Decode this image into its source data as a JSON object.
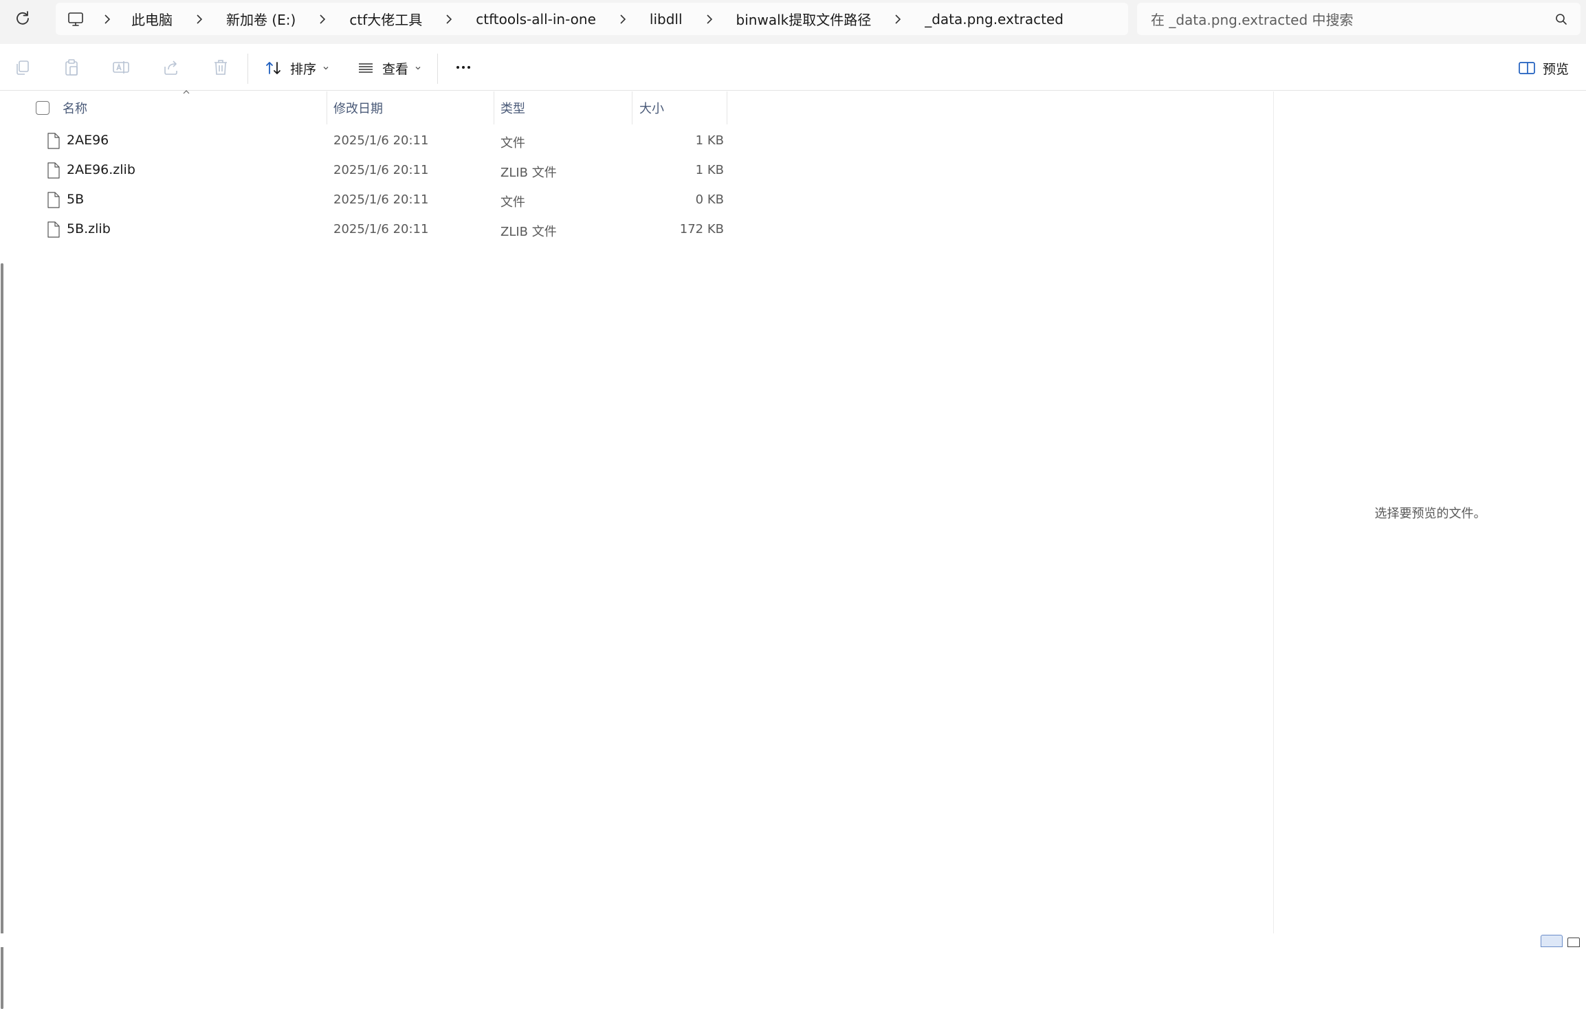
{
  "address_bar": {
    "breadcrumbs": [
      "此电脑",
      "新加卷 (E:)",
      "ctf大佬工具",
      "ctftools-all-in-one",
      "libdll",
      "binwalk提取文件路径",
      "_data.png.extracted"
    ],
    "search_placeholder": "在 _data.png.extracted 中搜索"
  },
  "toolbar": {
    "sort_label": "排序",
    "view_label": "查看",
    "preview_label": "预览"
  },
  "columns": {
    "name": "名称",
    "modified": "修改日期",
    "type": "类型",
    "size": "大小"
  },
  "files": [
    {
      "name": "2AE96",
      "modified": "2025/1/6 20:11",
      "type": "文件",
      "size": "1 KB"
    },
    {
      "name": "2AE96.zlib",
      "modified": "2025/1/6 20:11",
      "type": "ZLIB 文件",
      "size": "1 KB"
    },
    {
      "name": "5B",
      "modified": "2025/1/6 20:11",
      "type": "文件",
      "size": "0 KB"
    },
    {
      "name": "5B.zlib",
      "modified": "2025/1/6 20:11",
      "type": "ZLIB 文件",
      "size": "172 KB"
    }
  ],
  "preview": {
    "empty_message": "选择要预览的文件。"
  },
  "icons": {
    "refresh": "refresh-icon",
    "computer": "computer-icon",
    "chevron": "chevron-right-icon",
    "search": "search-icon",
    "copy": "copy-icon",
    "paste": "paste-icon",
    "rename": "rename-icon",
    "share": "share-icon",
    "delete": "delete-icon",
    "sort": "sort-icon",
    "view": "view-icon",
    "more": "more-icon",
    "preview": "preview-pane-icon",
    "file": "file-icon"
  },
  "colors": {
    "toolbar_bg": "#f3f3f3",
    "accent": "#1f5fbf",
    "header_text": "#4a5a78"
  }
}
